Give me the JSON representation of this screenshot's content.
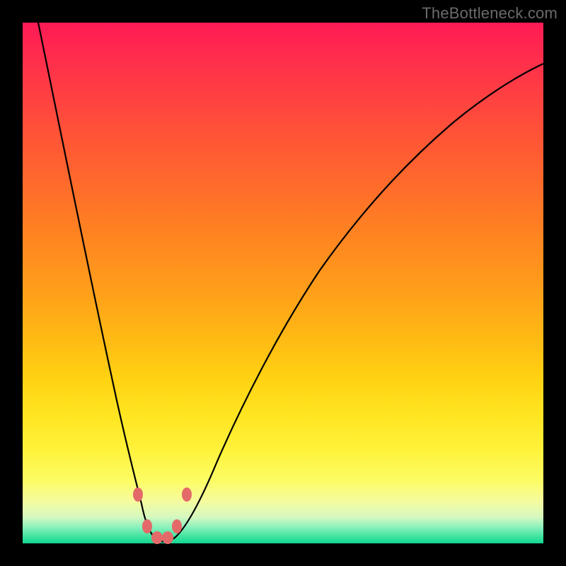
{
  "watermark": "TheBottleneck.com",
  "colors": {
    "background": "#000000",
    "curve": "#000000",
    "marker": "#e46a6a",
    "gradient_top": "#ff1a55",
    "gradient_bottom": "#14d595"
  },
  "chart_data": {
    "type": "line",
    "title": "",
    "xlabel": "",
    "ylabel": "",
    "xlim": [
      0,
      100
    ],
    "ylim": [
      0,
      100
    ],
    "grid": false,
    "note": "V-shaped bottleneck curve; y ≈ percentage bottleneck, minimum near x≈25. Values estimated from pixel positions (no axis ticks present).",
    "series": [
      {
        "name": "bottleneck-curve",
        "x": [
          3,
          5,
          8,
          11,
          14,
          17,
          19,
          21,
          23,
          24,
          25,
          27,
          28,
          30,
          33,
          37,
          42,
          48,
          55,
          63,
          72,
          82,
          92,
          100
        ],
        "y": [
          100,
          90,
          75,
          60,
          45,
          30,
          20,
          12,
          6,
          3,
          1,
          1,
          3,
          6,
          12,
          20,
          30,
          40,
          50,
          60,
          70,
          78,
          85,
          90
        ]
      }
    ],
    "markers": {
      "name": "highlight-points",
      "x": [
        21.5,
        23.5,
        25,
        27,
        28.5
      ],
      "y": [
        9,
        3,
        1,
        3,
        9
      ]
    }
  }
}
